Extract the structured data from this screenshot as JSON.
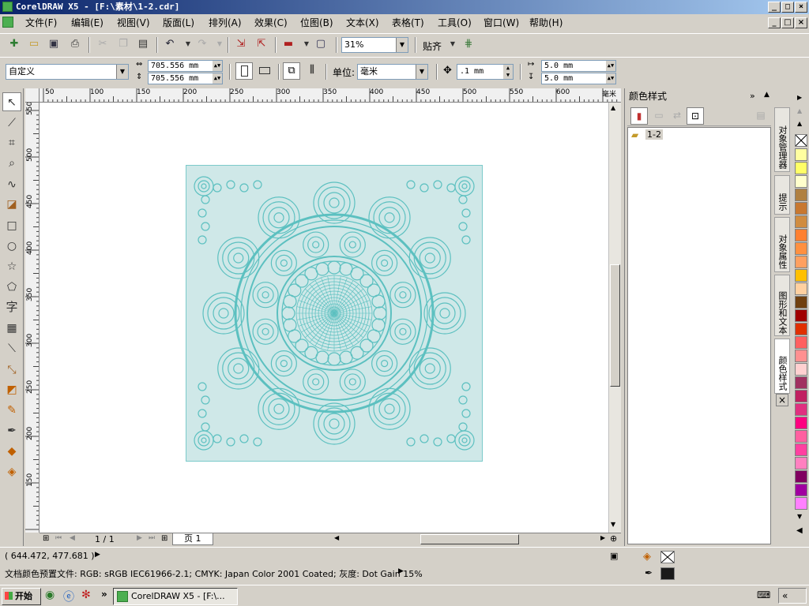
{
  "window": {
    "title": "CorelDRAW X5 - [F:\\素材\\1-2.cdr]",
    "min_label": "_",
    "max_label": "□",
    "close_label": "×"
  },
  "menu": [
    "文件(F)",
    "编辑(E)",
    "视图(V)",
    "版面(L)",
    "排列(A)",
    "效果(C)",
    "位图(B)",
    "文本(X)",
    "表格(T)",
    "工具(O)",
    "窗口(W)",
    "帮助(H)"
  ],
  "toolbar": {
    "zoom_value": "31%",
    "snap_label": "贴齐"
  },
  "property_bar": {
    "preset_value": "自定义",
    "width_value": "705.556 mm",
    "height_value": "705.556 mm",
    "units_label": "单位:",
    "units_value": "毫米",
    "nudge_value": ".1 mm",
    "dup_x_value": "5.0 mm",
    "dup_y_value": "5.0 mm"
  },
  "ruler": {
    "top_ticks": [
      "50",
      "100",
      "150",
      "200",
      "250",
      "300",
      "350",
      "400",
      "450",
      "500",
      "550",
      "600",
      "毫米"
    ],
    "left_ticks": [
      "550",
      "500",
      "450",
      "400",
      "350",
      "300",
      "250",
      "200",
      "150"
    ]
  },
  "toolbox": {
    "text_tool_glyph": "字"
  },
  "docker": {
    "title": "颜色样式",
    "tree_item": "1-2"
  },
  "side_tabs": [
    "对象管理器",
    "提示",
    "对象属性",
    "图形和文本",
    "颜色样式"
  ],
  "palette": {
    "colors": [
      "#ffffa0",
      "#ffff66",
      "#ffffcc",
      "#b08040",
      "#c87830",
      "#d08c40",
      "#ff8030",
      "#ff9040",
      "#ffa060",
      "#ffc000",
      "#ffd0a0",
      "#704010",
      "#a00000",
      "#e03000",
      "#ff6060",
      "#ff9090",
      "#ffd0d0",
      "#a03060",
      "#c02060",
      "#e03080",
      "#ff0080",
      "#ff60a0",
      "#ff40a0",
      "#ff80c0",
      "#800060",
      "#a000a0",
      "#ff80ff"
    ],
    "highlight_color": "#1a1a1a"
  },
  "pager": {
    "page_count": "1 / 1",
    "page_tab": "页 1"
  },
  "status": {
    "coordinates": "( 644.472, 477.681 )",
    "color_profile": "文档颜色预置文件: RGB: sRGB IEC61966-2.1; CMYK: Japan Color 2001 Coated; 灰度: Dot Gain 15%"
  },
  "taskbar": {
    "start_label": "开始",
    "task_label": "CorelDRAW X5 - [F:\\...",
    "extra_label": "»"
  }
}
